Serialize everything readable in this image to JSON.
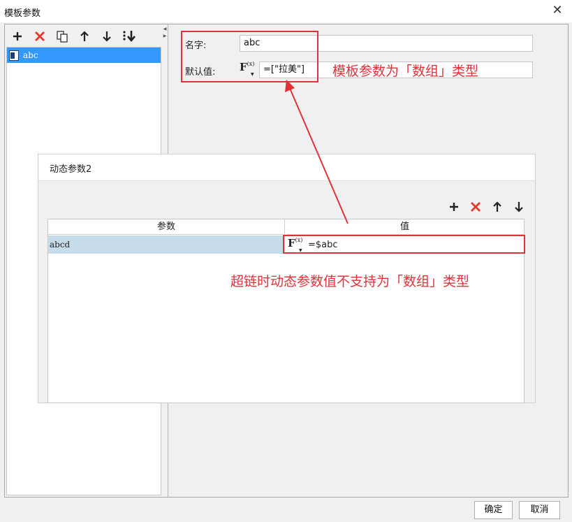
{
  "window": {
    "title": "模板参数",
    "close_glyph": "✕"
  },
  "left": {
    "toolbar": [
      {
        "name": "add-param-button",
        "icon": "plus-icon"
      },
      {
        "name": "delete-param-button",
        "icon": "red-x-icon"
      },
      {
        "name": "copy-param-button",
        "icon": "copy-icon"
      },
      {
        "name": "move-up-button",
        "icon": "arrow-up-icon"
      },
      {
        "name": "move-down-button",
        "icon": "arrow-down-icon"
      },
      {
        "name": "sort-button",
        "icon": "sort-down-icon"
      }
    ],
    "tree_items": [
      {
        "label": "abc",
        "selected": true
      }
    ]
  },
  "form": {
    "name_label": "名字:",
    "name_value": "abc",
    "default_label": "默认值:",
    "fx_label": "F",
    "fx_sub": "(x)",
    "default_value": "=[\"拉美\"]"
  },
  "annotations": {
    "top_note": "模板参数为「数组」类型",
    "bottom_note": "超链时动态参数值不支持为「数组」类型",
    "color": "#e0323a"
  },
  "dynamic_panel": {
    "title": "动态参数2",
    "columns": [
      "参数",
      "值"
    ],
    "rows": [
      {
        "param": "abcd",
        "value": "=$abc"
      }
    ]
  },
  "footer": {
    "ok_label": "确定",
    "cancel_label": "取消"
  }
}
